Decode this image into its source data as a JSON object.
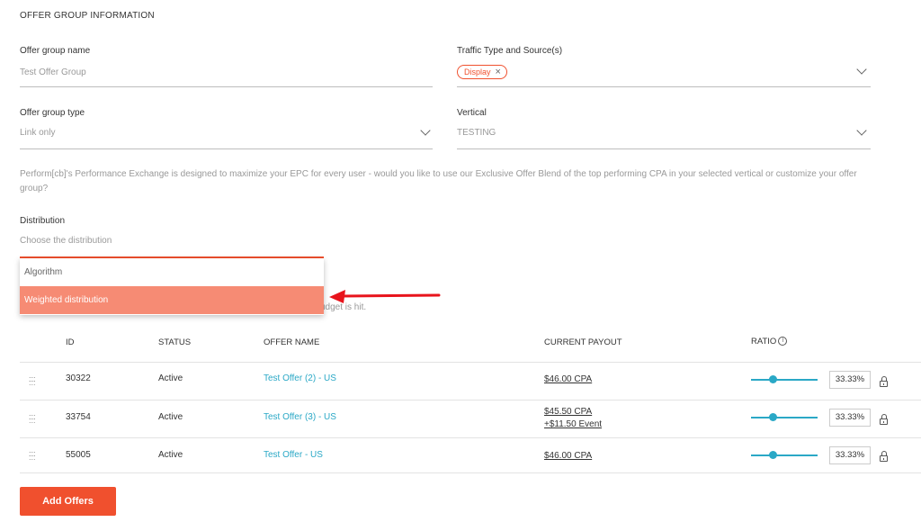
{
  "section": {
    "title": "OFFER GROUP INFORMATION"
  },
  "fields": {
    "name": {
      "label": "Offer group name",
      "placeholder": "Test Offer Group"
    },
    "traffic": {
      "label": "Traffic Type and Source(s)",
      "chip": "Display"
    },
    "type": {
      "label": "Offer group type",
      "value": "Link only"
    },
    "vertical": {
      "label": "Vertical",
      "value": "TESTING"
    }
  },
  "description": "Perform[cb]'s Performance Exchange is designed to maximize your EPC for every user - would you like to use our Exclusive Offer Blend of the top performing CPA in your selected vertical or customize your offer group?",
  "distribution": {
    "label": "Distribution",
    "placeholder": "Choose the distribution",
    "options": [
      "Algorithm",
      "Weighted distribution"
    ],
    "selected_index": 1
  },
  "hint_fragment": "udget is hit.",
  "table": {
    "headers": {
      "id": "ID",
      "status": "STATUS",
      "offer_name": "OFFER NAME",
      "payout": "CURRENT PAYOUT",
      "ratio": "RATIO"
    },
    "info_glyph": "i",
    "rows": [
      {
        "id": "30322",
        "status": "Active",
        "offer_name": "Test Offer (2) - US",
        "payout": "$46.00 CPA",
        "payout_extra": "",
        "ratio": "33.33%",
        "ratio_value": 0.3333
      },
      {
        "id": "33754",
        "status": "Active",
        "offer_name": "Test Offer (3) - US",
        "payout": "$45.50 CPA",
        "payout_extra": "+$11.50 Event",
        "ratio": "33.33%",
        "ratio_value": 0.3333
      },
      {
        "id": "55005",
        "status": "Active",
        "offer_name": "Test Offer - US",
        "payout": "$46.00 CPA",
        "payout_extra": "",
        "ratio": "33.33%",
        "ratio_value": 0.3333
      }
    ]
  },
  "actions": {
    "add_offers": "Add Offers"
  },
  "icons": {
    "chip_close": "×",
    "drag_handle": "drag-handle-icon",
    "lock": "lock-icon",
    "chevron": "chevron-down-icon",
    "info": "info-icon"
  },
  "colors": {
    "accent": "#f0502e",
    "selected_option": "#f68b74",
    "link": "#2aa8c6",
    "arrow": "#e8141c"
  }
}
